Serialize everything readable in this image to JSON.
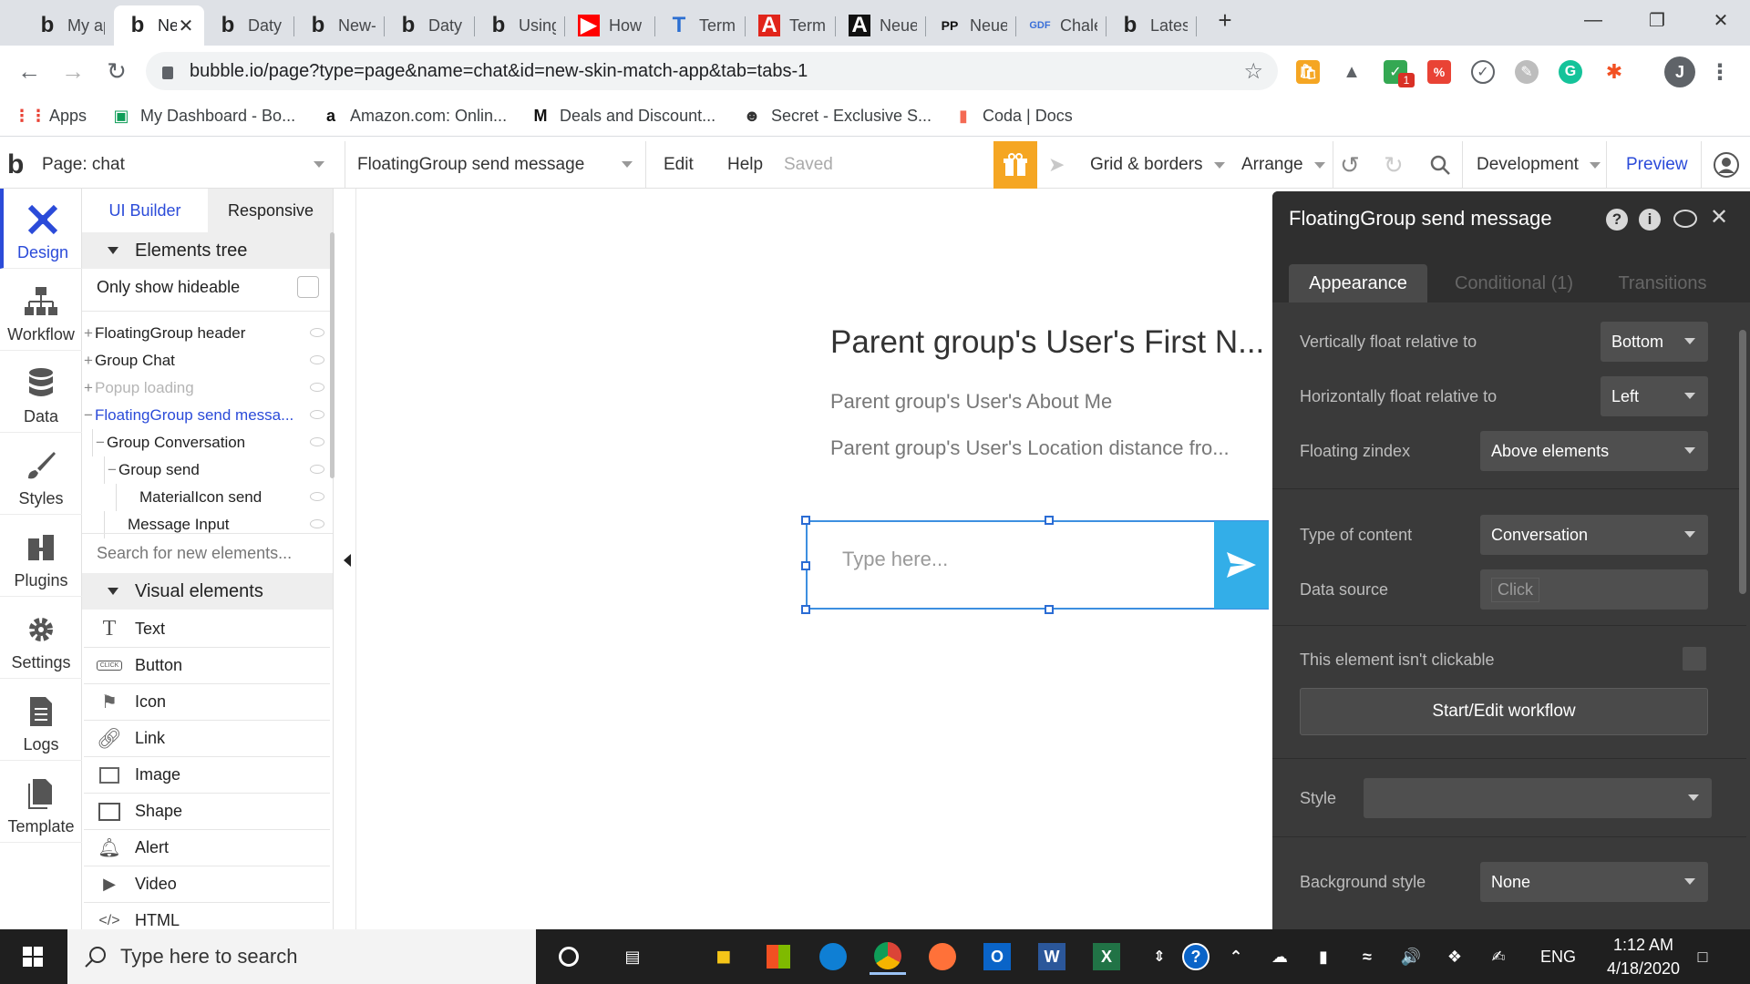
{
  "browser": {
    "tabs": [
      {
        "title": "My app",
        "icon": "bubble-icon",
        "active": false
      },
      {
        "title": "New",
        "icon": "bubble-icon",
        "active": true
      },
      {
        "title": "Daty - D",
        "icon": "bubble-icon",
        "active": false
      },
      {
        "title": "New-sk",
        "icon": "bubble-icon",
        "active": false
      },
      {
        "title": "Daty - D",
        "icon": "bubble-icon",
        "active": false
      },
      {
        "title": "Using C",
        "icon": "bubble-icon",
        "active": false
      },
      {
        "title": "How to",
        "icon": "youtube-icon",
        "active": false
      },
      {
        "title": "Termina",
        "icon": "typekit-icon",
        "active": false
      },
      {
        "title": "Termina",
        "icon": "adobe-icon",
        "active": false
      },
      {
        "title": "Neue M",
        "icon": "a-icon",
        "active": false
      },
      {
        "title": "Neue M",
        "icon": "pp-icon",
        "active": false
      },
      {
        "title": "Chalet",
        "icon": "gdf-icon",
        "active": false
      },
      {
        "title": "Latest",
        "icon": "bubble-icon",
        "active": false
      }
    ],
    "new_tab_label": "+",
    "close_tab_label": "✕",
    "window_controls": {
      "minimize": "—",
      "maximize": "❐",
      "close": "✕"
    },
    "url": "bubble.io/page?type=page&name=chat&id=new-skin-match-app&tab=tabs-1",
    "bookmarks": [
      {
        "label": "Apps",
        "icon": "apps-grid-icon"
      },
      {
        "label": "My Dashboard - Bo...",
        "icon": "dashboard-icon"
      },
      {
        "label": "Amazon.com: Onlin...",
        "icon": "amazon-icon"
      },
      {
        "label": "Deals and Discount...",
        "icon": "m-icon"
      },
      {
        "label": "Secret - Exclusive S...",
        "icon": "spy-icon"
      },
      {
        "label": "Coda | Docs",
        "icon": "coda-icon"
      }
    ],
    "profile_initial": "J",
    "badge_count": "1"
  },
  "editor_toolbar": {
    "page_label": "Page: chat",
    "element_selector": "FloatingGroup send message",
    "edit": "Edit",
    "help": "Help",
    "saved": "Saved",
    "grid_borders": "Grid & borders",
    "arrange": "Arrange",
    "development": "Development",
    "preview": "Preview"
  },
  "left_nav": [
    {
      "label": "Design",
      "icon": "design-icon",
      "active": true
    },
    {
      "label": "Workflow",
      "icon": "workflow-icon",
      "active": false
    },
    {
      "label": "Data",
      "icon": "database-icon",
      "active": false
    },
    {
      "label": "Styles",
      "icon": "brush-icon",
      "active": false
    },
    {
      "label": "Plugins",
      "icon": "plugin-icon",
      "active": false
    },
    {
      "label": "Settings",
      "icon": "gear-icon",
      "active": false
    },
    {
      "label": "Logs",
      "icon": "logs-icon",
      "active": false
    },
    {
      "label": "Template",
      "icon": "template-icon",
      "active": false
    }
  ],
  "elements_panel": {
    "tabs": [
      "UI Builder",
      "Responsive"
    ],
    "tree_title": "Elements tree",
    "only_hideable": "Only show hideable",
    "tree": [
      {
        "label": "FloatingGroup header",
        "prefix": "+",
        "indent": 0,
        "state": "normal"
      },
      {
        "label": "Group Chat",
        "prefix": "+",
        "indent": 0,
        "state": "normal"
      },
      {
        "label": "Popup loading",
        "prefix": "+",
        "indent": 0,
        "state": "muted"
      },
      {
        "label": "FloatingGroup send messa...",
        "prefix": "−",
        "indent": 0,
        "state": "selected"
      },
      {
        "label": "Group Conversation",
        "prefix": "−",
        "indent": 1,
        "state": "normal"
      },
      {
        "label": "Group send",
        "prefix": "−",
        "indent": 2,
        "state": "normal"
      },
      {
        "label": "MaterialIcon send",
        "prefix": "",
        "indent": 3,
        "state": "normal"
      },
      {
        "label": "Message Input",
        "prefix": "",
        "indent": 2,
        "state": "normal"
      }
    ],
    "search_placeholder": "Search for new elements...",
    "visual_title": "Visual elements",
    "visual": [
      {
        "label": "Text",
        "icon": "text-icon"
      },
      {
        "label": "Button",
        "icon": "button-icon"
      },
      {
        "label": "Icon",
        "icon": "flag-icon"
      },
      {
        "label": "Link",
        "icon": "link-icon"
      },
      {
        "label": "Image",
        "icon": "image-icon"
      },
      {
        "label": "Shape",
        "icon": "shape-icon"
      },
      {
        "label": "Alert",
        "icon": "bell-icon"
      },
      {
        "label": "Video",
        "icon": "video-icon"
      },
      {
        "label": "HTML",
        "icon": "code-icon"
      }
    ],
    "button_icon_text": "CLICK"
  },
  "canvas": {
    "title": "Parent group's User's First N...",
    "about": "Parent group's User's About Me",
    "location": "Parent group's User's Location distance fro...",
    "input_placeholder": "Type here..."
  },
  "property_editor": {
    "title": "FloatingGroup send message",
    "tabs": [
      "Appearance",
      "Conditional (1)",
      "Transitions"
    ],
    "fields": {
      "v_float_label": "Vertically float relative to",
      "v_float_value": "Bottom",
      "h_float_label": "Horizontally float relative to",
      "h_float_value": "Left",
      "zindex_label": "Floating zindex",
      "zindex_value": "Above elements",
      "content_label": "Type of content",
      "content_value": "Conversation",
      "source_label": "Data source",
      "source_value": "Click",
      "clickable_label": "This element isn't clickable",
      "workflow_button": "Start/Edit workflow",
      "style_label": "Style",
      "style_value": "",
      "bg_label": "Background style",
      "bg_value": "None"
    }
  },
  "taskbar": {
    "search_placeholder": "Type here to search",
    "language": "ENG",
    "time": "1:12 AM",
    "date": "4/18/2020"
  },
  "colors": {
    "accent_blue": "#2b4bd9",
    "send_blue": "#33aee8",
    "gift_orange": "#f5a623",
    "panel_dark": "#3a3a3a"
  }
}
